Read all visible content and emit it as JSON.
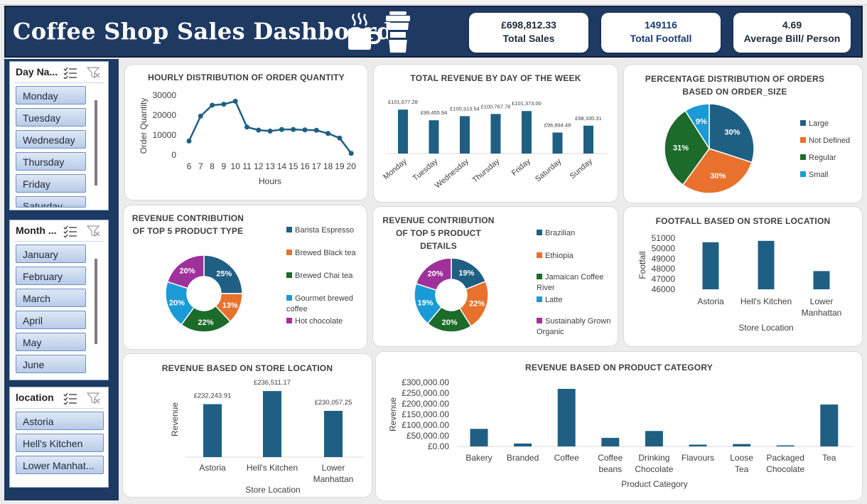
{
  "header": {
    "title": "Coffee Shop Sales Dashboard",
    "kpis": [
      {
        "value": "£698,812.33",
        "label": "Total Sales"
      },
      {
        "value": "149116",
        "label": "Total Footfall"
      },
      {
        "value": "4.69",
        "label": "Average Bill/ Person"
      }
    ]
  },
  "slicers": {
    "day": {
      "title": "Day Na...",
      "items": [
        "Monday",
        "Tuesday",
        "Wednesday",
        "Thursday",
        "Friday",
        "Saturday"
      ]
    },
    "month": {
      "title": "Month ...",
      "items": [
        "January",
        "February",
        "March",
        "April",
        "May",
        "June"
      ]
    },
    "location": {
      "title": "location",
      "items": [
        "Astoria",
        "Hell's Kitchen",
        "Lower Manhat..."
      ]
    }
  },
  "icons": {
    "cup": "coffee-mug-icon",
    "takeaway": "takeaway-cup-icon",
    "multiselect": "multi-select-icon",
    "clearfilter": "clear-filter-icon"
  },
  "colors": {
    "navy": "#1e3a63",
    "bar": "#1f5f84",
    "blue": "#1f5f84",
    "orange": "#e8712d",
    "green": "#1c6b2a",
    "cyan": "#1a9bd7",
    "purple": "#a0309a"
  },
  "chart_data": [
    {
      "type": "line",
      "title": "HOURLY DISTRIBUTION OF ORDER QUANTITY",
      "xlabel": "Hours",
      "ylabel": "Order Quantity",
      "x": [
        "6",
        "7",
        "8",
        "9",
        "10",
        "11",
        "12",
        "13",
        "14",
        "15",
        "16",
        "17",
        "18",
        "19",
        "20"
      ],
      "values": [
        7000,
        19500,
        25000,
        25500,
        27000,
        14000,
        12500,
        12000,
        12800,
        12800,
        12600,
        12400,
        10800,
        8500,
        800
      ],
      "yticks": [
        "0",
        "10000",
        "20000",
        "30000"
      ],
      "ylim": [
        0,
        30000
      ]
    },
    {
      "type": "bar",
      "title": "TOTAL REVENUE BY DAY OF THE WEEK",
      "categories": [
        "Monday",
        "Tuesday",
        "Wednesday",
        "Thursday",
        "Friday",
        "Saturday",
        "Sunday"
      ],
      "values": [
        101677.28,
        99455.94,
        100313.54,
        100767.78,
        101373.0,
        96894.48,
        98330.31
      ],
      "labels": [
        "£101,677.28",
        "£99,455.94",
        "£100,313.54",
        "£100,767.78",
        "£101,373.00",
        "£96,894.48",
        "£98,330.31"
      ]
    },
    {
      "type": "pie",
      "title": "PERCENTAGE DISTRIBUTION OF ORDERS BASED ON ORDER_SIZE",
      "categories": [
        "Large",
        "Not Defined",
        "Regular",
        "Small"
      ],
      "values": [
        30,
        30,
        31,
        9
      ],
      "labels": [
        "30%",
        "30%",
        "31%",
        "9%"
      ]
    },
    {
      "type": "pie",
      "title": "REVENUE CONTRIBUTION  OF TOP 5 PRODUCT TYPE",
      "categories": [
        "Barista Espresso",
        "Brewed Black tea",
        "Brewed Chai tea",
        "Gourmet brewed coffee",
        "Hot chocolate"
      ],
      "values": [
        25,
        13,
        22,
        20,
        20
      ],
      "labels": [
        "25%",
        "13%",
        "22%",
        "20%",
        "20%"
      ]
    },
    {
      "type": "pie",
      "title": "REVENUE CONTRIBUTION  OF TOP 5 PRODUCT DETAILS",
      "categories": [
        "Brazilian",
        "Ethiopia",
        "Jamaican Coffee River",
        "Latte",
        "Sustainably Grown Organic"
      ],
      "values": [
        19,
        22,
        20,
        19,
        20
      ],
      "labels": [
        "19%",
        "22%",
        "20%",
        "19%",
        "20%"
      ]
    },
    {
      "type": "bar",
      "title": "FOOTFALL BASED ON STORE LOCATION",
      "categories": [
        "Astoria",
        "Hell's Kitchen",
        "Lower Manhattan"
      ],
      "values": [
        50599,
        50735,
        47782
      ],
      "xlabel": "Store Location",
      "ylabel": "Footfall",
      "yticks": [
        "46000",
        "47000",
        "48000",
        "49000",
        "50000",
        "51000"
      ],
      "ylim": [
        46000,
        51000
      ]
    },
    {
      "type": "bar",
      "title": "REVENUE BASED ON STORE LOCATION",
      "categories": [
        "Astoria",
        "Hell's Kitchen",
        "Lower Manhattan"
      ],
      "values": [
        232243.91,
        236511.17,
        230057.25
      ],
      "labels": [
        "£232,243.91",
        "£236,511.17",
        "£230,057.25"
      ],
      "xlabel": "Store Location",
      "ylabel": "Revenue"
    },
    {
      "type": "bar",
      "title": "REVENUE BASED ON PRODUCT CATEGORY",
      "categories": [
        "Bakery",
        "Branded",
        "Coffee",
        "Coffee beans",
        "Drinking Chocolate",
        "Flavours",
        "Loose Tea",
        "Packaged Chocolate",
        "Tea"
      ],
      "values": [
        82315,
        13607,
        269952,
        40085,
        72416,
        8409,
        11213,
        4408,
        196405
      ],
      "xlabel": "Product Category",
      "ylabel": "Revenue",
      "yticks": [
        "£0.00",
        "£50,000.00",
        "£100,000.00",
        "£150,000.00",
        "£200,000.00",
        "£250,000.00",
        "£300,000.00"
      ],
      "ylim": [
        0,
        300000
      ]
    }
  ]
}
